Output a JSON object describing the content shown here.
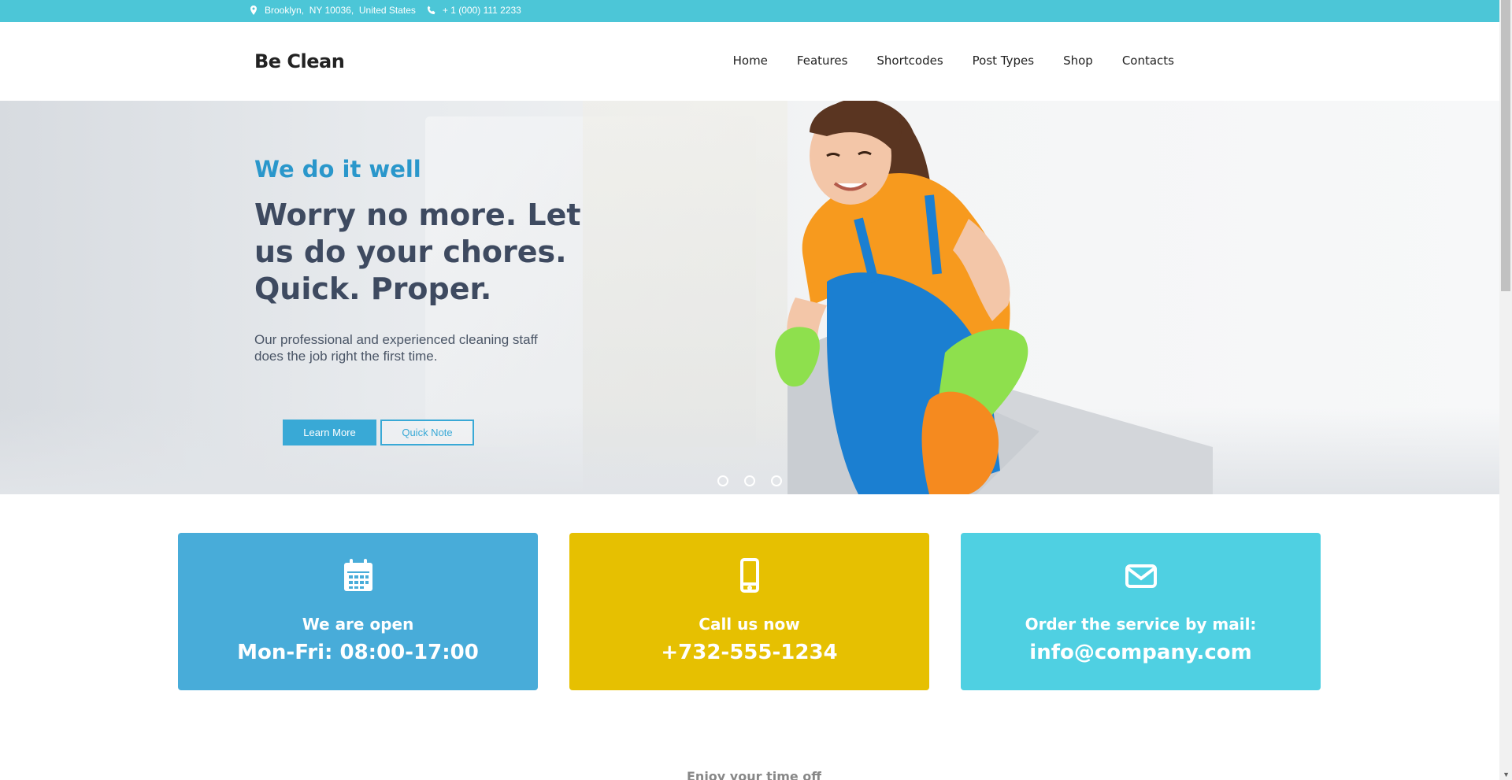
{
  "topbar": {
    "address": "Brooklyn,  NY 10036,  United States",
    "phone": "+ 1 (000) 111 2233"
  },
  "header": {
    "logo": "Be Clean",
    "nav": [
      "Home",
      "Features",
      "Shortcodes",
      "Post Types",
      "Shop",
      "Contacts"
    ]
  },
  "hero": {
    "subtitle": "We do it well",
    "title": "Worry no more. Let us do your chores. Quick. Proper.",
    "description": "Our professional and experienced cleaning staff does the job right the first time.",
    "primary_button": "Learn More",
    "secondary_button": "Quick Note",
    "slides": 3
  },
  "boxes": [
    {
      "icon": "calendar-icon",
      "title": "We are open",
      "value": "Mon-Fri: 08:00-17:00",
      "color": "#48acd9"
    },
    {
      "icon": "mobile-phone-icon",
      "title": "Call us now",
      "value": "+732-555-1234",
      "color": "#e6c001"
    },
    {
      "icon": "envelope-icon",
      "title": "Order the service by mail:",
      "value": "info@company.com",
      "color": "#4fd0e2"
    }
  ],
  "partial_heading": "Enjoy your time off",
  "colors": {
    "topbar": "#4cc6d7",
    "accent": "#39a9d6",
    "heading": "#3e4a60"
  }
}
